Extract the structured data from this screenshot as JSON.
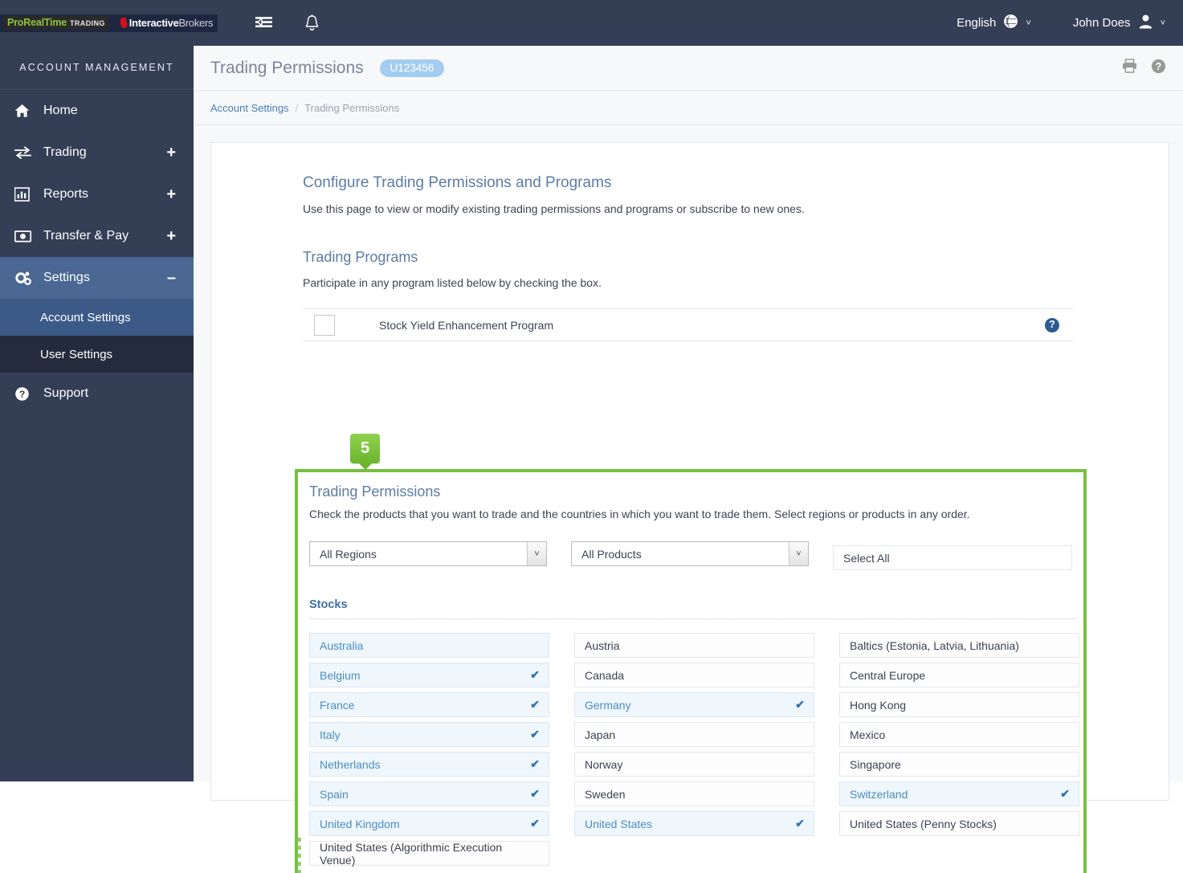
{
  "topbar": {
    "logo_prt_main": "ProRealTime",
    "logo_prt_sub": "TRADING",
    "logo_ib_bold": "Interactive",
    "logo_ib_light": "Brokers",
    "menu_icon": "menu-collapse-icon",
    "bell_icon": "notifications-bell-icon",
    "language": "English",
    "language_icon": "globe-icon",
    "user": "John Does",
    "user_icon": "user-avatar-icon",
    "caret": "˅"
  },
  "sidebar": {
    "title": "ACCOUNT MANAGEMENT",
    "items": [
      {
        "label": "Home",
        "icon": "home-icon",
        "expander": ""
      },
      {
        "label": "Trading",
        "icon": "exchange-icon",
        "expander": "+"
      },
      {
        "label": "Reports",
        "icon": "bar-chart-icon",
        "expander": "+"
      },
      {
        "label": "Transfer & Pay",
        "icon": "money-icon",
        "expander": "+"
      },
      {
        "label": "Settings",
        "icon": "gears-icon",
        "expander": "–"
      }
    ],
    "sub_items": [
      {
        "label": "Account Settings"
      },
      {
        "label": "User Settings"
      }
    ],
    "support": {
      "label": "Support",
      "icon": "question-circle-icon"
    }
  },
  "header": {
    "title": "Trading Permissions",
    "account_badge": "U123456",
    "print_icon": "printer-icon",
    "help_icon": "help-circle-icon"
  },
  "breadcrumb": {
    "parent": "Account Settings",
    "separator": "/",
    "current": "Trading Permissions"
  },
  "main": {
    "configure_title": "Configure Trading Permissions and Programs",
    "configure_desc": "Use this page to view or modify existing trading permissions and programs or subscribe to new ones.",
    "programs_title": "Trading Programs",
    "programs_desc": "Participate in any program listed below by checking the box.",
    "programs": [
      {
        "label": "Stock Yield Enhancement Program",
        "checked": false,
        "help": "?"
      }
    ]
  },
  "highlight": {
    "step_number": "5",
    "border_color": "#76c043",
    "title": "Trading Permissions",
    "desc": "Check the products that you want to trade and the countries in which you want to trade them. Select regions or products in any order.",
    "region_select": {
      "value": "All Regions",
      "arrow": "˅"
    },
    "product_select": {
      "value": "All Products",
      "arrow": "˅"
    },
    "select_all": "Select All",
    "section_label": "Stocks",
    "check_glyph": "✔",
    "accent_selected": "#4a8ec2",
    "columns": [
      [
        {
          "label": "Australia",
          "selected": false
        },
        {
          "label": "Belgium",
          "selected": true
        },
        {
          "label": "France",
          "selected": true
        },
        {
          "label": "Italy",
          "selected": true
        },
        {
          "label": "Netherlands",
          "selected": true
        },
        {
          "label": "Spain",
          "selected": true
        },
        {
          "label": "United Kingdom",
          "selected": true
        },
        {
          "label": "United States (Algorithmic Execution Venue)",
          "selected": false
        }
      ],
      [
        {
          "label": "Austria",
          "selected": false
        },
        {
          "label": "Canada",
          "selected": false
        },
        {
          "label": "Germany",
          "selected": true
        },
        {
          "label": "Japan",
          "selected": false
        },
        {
          "label": "Norway",
          "selected": false
        },
        {
          "label": "Sweden",
          "selected": false
        },
        {
          "label": "United States",
          "selected": true
        }
      ],
      [
        {
          "label": "Baltics (Estonia, Latvia, Lithuania)",
          "selected": false
        },
        {
          "label": "Central Europe",
          "selected": false
        },
        {
          "label": "Hong Kong",
          "selected": false
        },
        {
          "label": "Mexico",
          "selected": false
        },
        {
          "label": "Singapore",
          "selected": false
        },
        {
          "label": "Switzerland",
          "selected": true
        },
        {
          "label": "United States (Penny Stocks)",
          "selected": false
        }
      ]
    ]
  }
}
